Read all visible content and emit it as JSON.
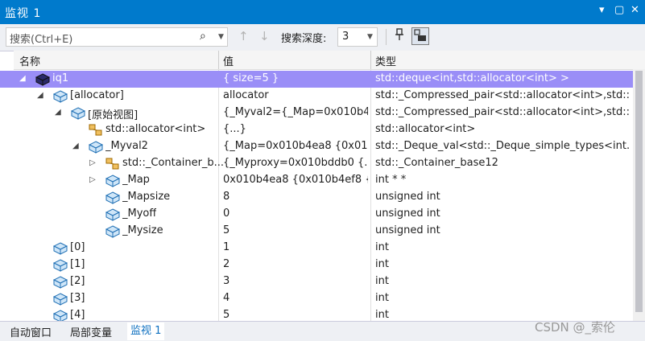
{
  "window": {
    "title": "监视 1",
    "controls": [
      "▾",
      "▢",
      "✕"
    ]
  },
  "toolbar": {
    "search_placeholder": "搜索(Ctrl+E)",
    "depth_label": "搜索深度:",
    "depth_value": "3"
  },
  "columns": {
    "name": "名称",
    "value": "值",
    "type": "类型"
  },
  "rows": [
    {
      "name": "iq1",
      "value": "{ size=5 }",
      "type": "std::deque<int,std::allocator<int> >",
      "indent": 0,
      "expander": "open",
      "icon": "cube-icon",
      "selected": true
    },
    {
      "name": "[allocator]",
      "value": "allocator",
      "type": "std::_Compressed_pair<std::allocator<int>,std::...",
      "indent": 1,
      "expander": "open",
      "icon": "cube-icon"
    },
    {
      "name": "[原始视图]",
      "value": "{_Myval2={_Map=0x010b4...",
      "type": "std::_Compressed_pair<std::allocator<int>,std::...",
      "indent": 2,
      "expander": "open",
      "icon": "cube-icon"
    },
    {
      "name": "std::allocator<int>",
      "value": "{...}",
      "type": "std::allocator<int>",
      "indent": 3,
      "expander": "none",
      "icon": "base-class-icon"
    },
    {
      "name": "_Myval2",
      "value": "{_Map=0x010b4ea8 {0x01...",
      "type": "std::_Deque_val<std::_Deque_simple_types<int...",
      "indent": 3,
      "expander": "open",
      "icon": "cube-icon"
    },
    {
      "name": "std::_Container_b...",
      "value": "{_Myproxy=0x010bddb0 {...",
      "type": "std::_Container_base12",
      "indent": 4,
      "expander": "closed",
      "icon": "base-class-icon"
    },
    {
      "name": "_Map",
      "value": "0x010b4ea8 {0x010b4ef8 {...",
      "type": "int * *",
      "indent": 4,
      "expander": "closed",
      "icon": "cube-icon"
    },
    {
      "name": "_Mapsize",
      "value": "8",
      "type": "unsigned int",
      "indent": 4,
      "expander": "none",
      "icon": "cube-icon"
    },
    {
      "name": "_Myoff",
      "value": "0",
      "type": "unsigned int",
      "indent": 4,
      "expander": "none",
      "icon": "cube-icon"
    },
    {
      "name": "_Mysize",
      "value": "5",
      "type": "unsigned int",
      "indent": 4,
      "expander": "none",
      "icon": "cube-icon"
    },
    {
      "name": "[0]",
      "value": "1",
      "type": "int",
      "indent": 1,
      "expander": "none",
      "icon": "cube-icon"
    },
    {
      "name": "[1]",
      "value": "2",
      "type": "int",
      "indent": 1,
      "expander": "none",
      "icon": "cube-icon"
    },
    {
      "name": "[2]",
      "value": "3",
      "type": "int",
      "indent": 1,
      "expander": "none",
      "icon": "cube-icon"
    },
    {
      "name": "[3]",
      "value": "4",
      "type": "int",
      "indent": 1,
      "expander": "none",
      "icon": "cube-icon"
    },
    {
      "name": "[4]",
      "value": "5",
      "type": "int",
      "indent": 1,
      "expander": "none",
      "icon": "cube-icon"
    }
  ],
  "tabs": [
    {
      "label": "自动窗口",
      "active": false
    },
    {
      "label": "局部变量",
      "active": false
    },
    {
      "label": "监视 1",
      "active": true
    }
  ],
  "watermark": "CSDN @_索伦",
  "colors": {
    "title_bar": "#007acc",
    "selected_row": "#9a8ef7",
    "active_tab": "#0e70c0"
  }
}
